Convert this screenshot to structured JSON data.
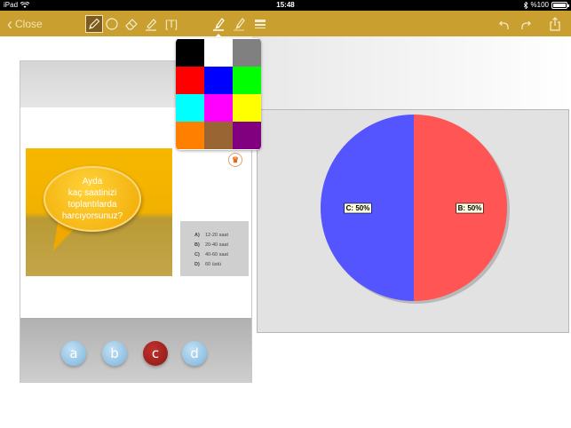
{
  "status_bar": {
    "device": "iPad",
    "time": "15:48",
    "battery": "%100"
  },
  "toolbar": {
    "close_label": "Close",
    "text_tool_label": "[T]",
    "color": "#c9a030",
    "tools": [
      "pencil-icon",
      "circle-icon",
      "eraser-icon",
      "highlighter-icon",
      "text-icon",
      "pen-color-icon",
      "pen-width-icon",
      "line-style-icon"
    ],
    "right_tools": [
      "undo-icon",
      "redo-icon",
      "share-icon"
    ]
  },
  "slide": {
    "question_lines": [
      "Ayda",
      "kaç saatinizi",
      "toplantılarda",
      "harcıyorsunuz?"
    ],
    "answers": [
      {
        "key": "A)",
        "text": "12-20 saat"
      },
      {
        "key": "B)",
        "text": "20-40 saat"
      },
      {
        "key": "C)",
        "text": "40-60 saat"
      },
      {
        "key": "D)",
        "text": "60 üstü"
      }
    ],
    "choices": [
      {
        "label": "a",
        "selected": false
      },
      {
        "label": "b",
        "selected": false
      },
      {
        "label": "c",
        "selected": true
      },
      {
        "label": "d",
        "selected": false
      }
    ]
  },
  "color_picker": {
    "swatches": [
      "#000000",
      "#ffffff",
      "#808080",
      "#ff0000",
      "#0000ff",
      "#00ff00",
      "#00ffff",
      "#ff00ff",
      "#ffff00",
      "#ff8000",
      "#996633",
      "#800080"
    ]
  },
  "chart_data": {
    "type": "pie",
    "slices": [
      {
        "name": "B",
        "label": "B: 50%",
        "value": 50,
        "color": "#ff5555"
      },
      {
        "name": "C",
        "label": "C: 50%",
        "value": 50,
        "color": "#5555ff"
      }
    ]
  }
}
